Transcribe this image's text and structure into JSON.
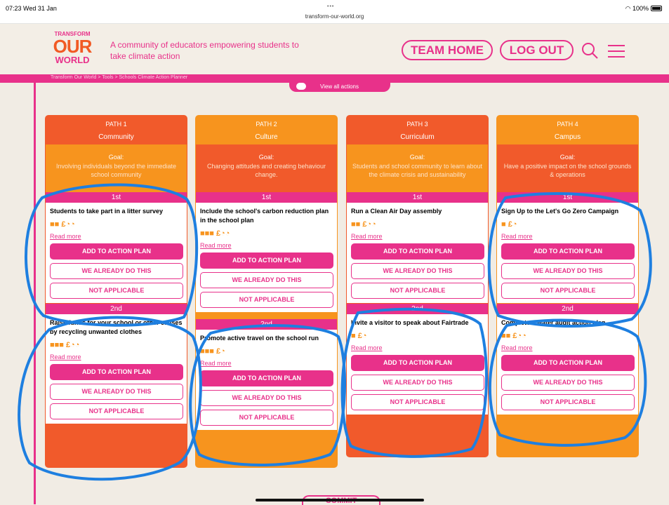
{
  "status_bar": {
    "time": "07:23  Wed 31 Jan",
    "dots": "•••",
    "url": "transform-our-world.org",
    "battery": "100%"
  },
  "header": {
    "logo": {
      "line1": "TRANSFORM",
      "line2": "OUR",
      "line3": "WORLD"
    },
    "tagline": "A community of educators empowering students to take climate action",
    "team_home": "TEAM HOME",
    "log_out": "LOG OUT",
    "search_icon": "search-icon",
    "menu_icon": "hamburger-menu-icon"
  },
  "breadcrumb": "Transform Our World > Tools > Schools Climate Action Planner",
  "view_all": "View all actions",
  "buttons": {
    "add": "ADD TO ACTION PLAN",
    "already": "WE ALREADY DO THIS",
    "na": "NOT APPLICABLE"
  },
  "read_more": "Read more",
  "bottom_button": "COMMIT",
  "colors": {
    "pink": "#e8318a",
    "orange": "#f7941e",
    "red": "#f15a2b",
    "annotation": "#1e7fe0"
  },
  "paths": [
    {
      "number": "PATH 1",
      "title": "Community",
      "goal_label": "Goal:",
      "goal": "Involving individuals beyond the immediate school community",
      "actions": [
        {
          "rank": "1st",
          "title": "Students to take part in a litter survey",
          "icons": "■■ £◔◔"
        },
        {
          "rank": "2nd",
          "title": "Raise funds for your school or other causes by recycling unwanted clothes",
          "icons": "■■■ £◔◔"
        }
      ]
    },
    {
      "number": "PATH 2",
      "title": "Culture",
      "goal_label": "Goal:",
      "goal": "Changing attitudes and creating behaviour change.",
      "actions": [
        {
          "rank": "1st",
          "title": "Include the school's carbon reduction plan in the school plan",
          "icons": "■■■ £◔◔"
        },
        {
          "rank": "2nd",
          "title": "Promote active travel on the school run",
          "icons": "■■■ £◔"
        }
      ]
    },
    {
      "number": "PATH 3",
      "title": "Curriculum",
      "goal_label": "Goal:",
      "goal": "Students and school community to learn about the climate crisis and sustainability",
      "actions": [
        {
          "rank": "1st",
          "title": "Run a Clean Air Day assembly",
          "icons": "■■ £◔◔"
        },
        {
          "rank": "2nd",
          "title": "Invite a visitor to speak about Fairtrade",
          "icons": "■ £◔"
        }
      ]
    },
    {
      "number": "PATH 4",
      "title": "Campus",
      "goal_label": "Goal:",
      "goal": "Have a positive impact on the school grounds & operations",
      "actions": [
        {
          "rank": "1st",
          "title": "Sign Up to the Let's Go Zero Campaign",
          "icons": "■ £◔"
        },
        {
          "rank": "2nd",
          "title": "Complete a water audit action plan",
          "icons": "■■ £◔◔"
        }
      ]
    }
  ]
}
